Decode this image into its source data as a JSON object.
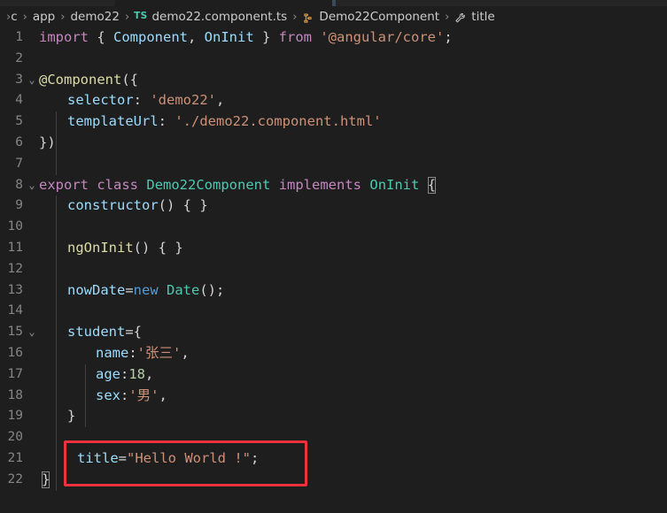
{
  "window": {
    "theme": "vscode-dark-plus",
    "background": "#1e1e1e",
    "tabbar_background": "#252526"
  },
  "breadcrumb": {
    "name": "breadcrumb",
    "items": [
      {
        "label": "c",
        "icon": "",
        "clipped": true
      },
      {
        "label": "app",
        "icon": ""
      },
      {
        "label": "demo22",
        "icon": ""
      },
      {
        "label": "demo22.component.ts",
        "icon": "typescript-file-icon",
        "icon_text": "TS"
      },
      {
        "label": "Demo22Component",
        "icon": "class-symbol-icon"
      },
      {
        "label": "title",
        "icon": "property-symbol-icon"
      }
    ],
    "separator": "›"
  },
  "editor": {
    "language": "TypeScript",
    "fold_marker": "⌄",
    "lines": [
      {
        "n": "1",
        "fold": false,
        "indent": 0
      },
      {
        "n": "2",
        "fold": false,
        "indent": 0
      },
      {
        "n": "3",
        "fold": true,
        "indent": 0
      },
      {
        "n": "4",
        "fold": false,
        "indent": 1
      },
      {
        "n": "5",
        "fold": false,
        "indent": 1
      },
      {
        "n": "6",
        "fold": false,
        "indent": 0
      },
      {
        "n": "7",
        "fold": false,
        "indent": 0
      },
      {
        "n": "8",
        "fold": true,
        "indent": 0
      },
      {
        "n": "9",
        "fold": false,
        "indent": 1
      },
      {
        "n": "10",
        "fold": false,
        "indent": 1
      },
      {
        "n": "11",
        "fold": false,
        "indent": 1
      },
      {
        "n": "12",
        "fold": false,
        "indent": 1
      },
      {
        "n": "13",
        "fold": false,
        "indent": 1
      },
      {
        "n": "14",
        "fold": false,
        "indent": 1
      },
      {
        "n": "15",
        "fold": true,
        "indent": 1
      },
      {
        "n": "16",
        "fold": false,
        "indent": 2
      },
      {
        "n": "17",
        "fold": false,
        "indent": 2
      },
      {
        "n": "18",
        "fold": false,
        "indent": 2
      },
      {
        "n": "19",
        "fold": false,
        "indent": 1
      },
      {
        "n": "20",
        "fold": false,
        "indent": 1
      },
      {
        "n": "21",
        "fold": false,
        "indent": 1
      },
      {
        "n": "22",
        "fold": false,
        "indent": 0
      }
    ],
    "source_text": [
      "import { Component, OnInit } from '@angular/core';",
      "",
      "@Component({",
      "    selector: 'demo22',",
      "    templateUrl: './demo22.component.html'",
      "})",
      "",
      "export class Demo22Component implements OnInit {",
      "    constructor() { }",
      "",
      "    ngOnInit() { }",
      "",
      "    nowDate=new Date();",
      "",
      "    student={",
      "        name:'张三',",
      "        age:18,",
      "        sex:'男',",
      "    }",
      "",
      "    title=\"Hello World !\";",
      "}"
    ]
  },
  "tokens": {
    "l1": {
      "import": "import",
      "brace_open": " { ",
      "component": "Component",
      "comma": ", ",
      "oninit": "OnInit",
      "brace_close": " } ",
      "from": "from",
      "space": " ",
      "module": "'@angular/core'",
      "semi": ";"
    },
    "l3": {
      "decorator": "@Component",
      "open": "({"
    },
    "l4": {
      "key": "selector",
      "colon": ": ",
      "value": "'demo22'",
      "comma": ","
    },
    "l5": {
      "key": "templateUrl",
      "colon": ": ",
      "value": "'./demo22.component.html'"
    },
    "l6": {
      "close": "})"
    },
    "l8": {
      "export": "export",
      "class": "class",
      "name": "Demo22Component",
      "implements": "implements",
      "iface": "OnInit",
      "brace": "{"
    },
    "l9": {
      "ctor": "constructor",
      "parens": "()",
      "body": " { }"
    },
    "l11": {
      "fn": "ngOnInit",
      "parens": "()",
      "body": " { }"
    },
    "l13": {
      "name": "nowDate",
      "eq": "=",
      "new": "new",
      "type": "Date",
      "call": "();"
    },
    "l15": {
      "name": "student",
      "eq": "={"
    },
    "l16": {
      "key": "name",
      "colon": ":",
      "value": "'张三'",
      "comma": ","
    },
    "l17": {
      "key": "age",
      "colon": ":",
      "value": "18",
      "comma": ","
    },
    "l18": {
      "key": "sex",
      "colon": ":",
      "value": "'男'",
      "comma": ","
    },
    "l19": {
      "close": "}"
    },
    "l21": {
      "name": "title",
      "eq": "=",
      "value": "\"Hello World !\"",
      "semi": ";"
    },
    "l22": {
      "close": "}"
    }
  },
  "annotation": {
    "name": "red-highlight-box",
    "color": "#f0323c",
    "target_line": "21",
    "target_text": "title=\"Hello World !\";"
  },
  "colors": {
    "keyword": "#c586c0",
    "keyword_control": "#569cd6",
    "variable": "#9cdcfe",
    "type": "#4ec9b0",
    "function": "#dcdcaa",
    "string": "#ce9178",
    "number": "#b5cea8",
    "plain": "#d4d4d4",
    "line_number": "#858585",
    "indent_guide": "#404040"
  }
}
